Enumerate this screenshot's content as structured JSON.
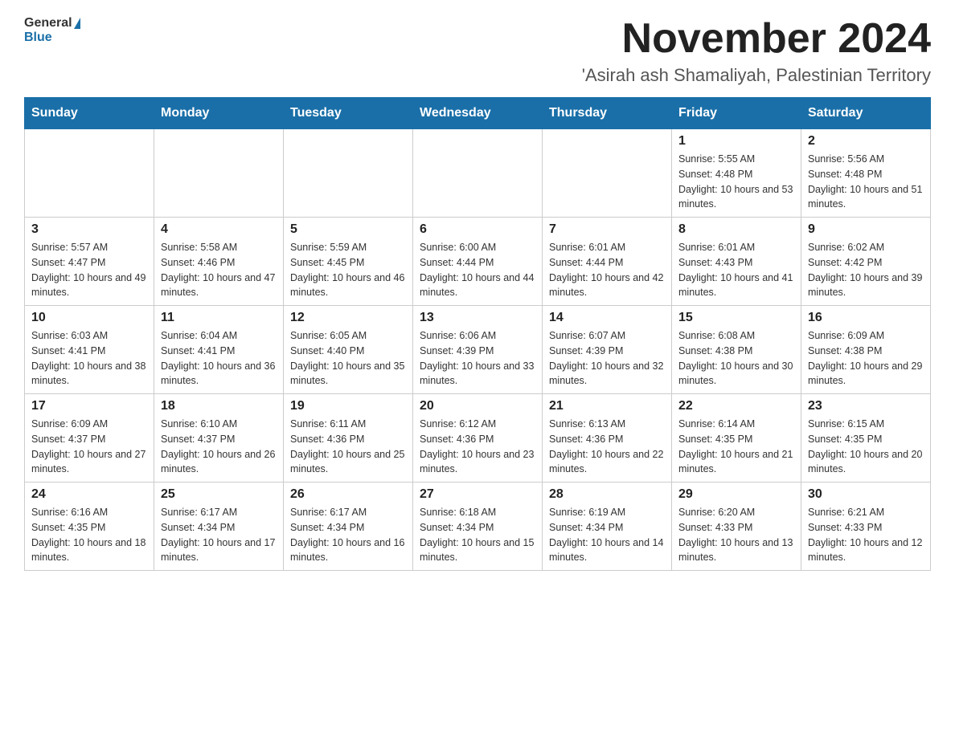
{
  "header": {
    "logo_general": "General",
    "logo_blue": "Blue",
    "month_title": "November 2024",
    "subtitle": "'Asirah ash Shamaliyah, Palestinian Territory"
  },
  "days_of_week": [
    "Sunday",
    "Monday",
    "Tuesday",
    "Wednesday",
    "Thursday",
    "Friday",
    "Saturday"
  ],
  "weeks": [
    [
      {
        "day": "",
        "info": ""
      },
      {
        "day": "",
        "info": ""
      },
      {
        "day": "",
        "info": ""
      },
      {
        "day": "",
        "info": ""
      },
      {
        "day": "",
        "info": ""
      },
      {
        "day": "1",
        "info": "Sunrise: 5:55 AM\nSunset: 4:48 PM\nDaylight: 10 hours and 53 minutes."
      },
      {
        "day": "2",
        "info": "Sunrise: 5:56 AM\nSunset: 4:48 PM\nDaylight: 10 hours and 51 minutes."
      }
    ],
    [
      {
        "day": "3",
        "info": "Sunrise: 5:57 AM\nSunset: 4:47 PM\nDaylight: 10 hours and 49 minutes."
      },
      {
        "day": "4",
        "info": "Sunrise: 5:58 AM\nSunset: 4:46 PM\nDaylight: 10 hours and 47 minutes."
      },
      {
        "day": "5",
        "info": "Sunrise: 5:59 AM\nSunset: 4:45 PM\nDaylight: 10 hours and 46 minutes."
      },
      {
        "day": "6",
        "info": "Sunrise: 6:00 AM\nSunset: 4:44 PM\nDaylight: 10 hours and 44 minutes."
      },
      {
        "day": "7",
        "info": "Sunrise: 6:01 AM\nSunset: 4:44 PM\nDaylight: 10 hours and 42 minutes."
      },
      {
        "day": "8",
        "info": "Sunrise: 6:01 AM\nSunset: 4:43 PM\nDaylight: 10 hours and 41 minutes."
      },
      {
        "day": "9",
        "info": "Sunrise: 6:02 AM\nSunset: 4:42 PM\nDaylight: 10 hours and 39 minutes."
      }
    ],
    [
      {
        "day": "10",
        "info": "Sunrise: 6:03 AM\nSunset: 4:41 PM\nDaylight: 10 hours and 38 minutes."
      },
      {
        "day": "11",
        "info": "Sunrise: 6:04 AM\nSunset: 4:41 PM\nDaylight: 10 hours and 36 minutes."
      },
      {
        "day": "12",
        "info": "Sunrise: 6:05 AM\nSunset: 4:40 PM\nDaylight: 10 hours and 35 minutes."
      },
      {
        "day": "13",
        "info": "Sunrise: 6:06 AM\nSunset: 4:39 PM\nDaylight: 10 hours and 33 minutes."
      },
      {
        "day": "14",
        "info": "Sunrise: 6:07 AM\nSunset: 4:39 PM\nDaylight: 10 hours and 32 minutes."
      },
      {
        "day": "15",
        "info": "Sunrise: 6:08 AM\nSunset: 4:38 PM\nDaylight: 10 hours and 30 minutes."
      },
      {
        "day": "16",
        "info": "Sunrise: 6:09 AM\nSunset: 4:38 PM\nDaylight: 10 hours and 29 minutes."
      }
    ],
    [
      {
        "day": "17",
        "info": "Sunrise: 6:09 AM\nSunset: 4:37 PM\nDaylight: 10 hours and 27 minutes."
      },
      {
        "day": "18",
        "info": "Sunrise: 6:10 AM\nSunset: 4:37 PM\nDaylight: 10 hours and 26 minutes."
      },
      {
        "day": "19",
        "info": "Sunrise: 6:11 AM\nSunset: 4:36 PM\nDaylight: 10 hours and 25 minutes."
      },
      {
        "day": "20",
        "info": "Sunrise: 6:12 AM\nSunset: 4:36 PM\nDaylight: 10 hours and 23 minutes."
      },
      {
        "day": "21",
        "info": "Sunrise: 6:13 AM\nSunset: 4:36 PM\nDaylight: 10 hours and 22 minutes."
      },
      {
        "day": "22",
        "info": "Sunrise: 6:14 AM\nSunset: 4:35 PM\nDaylight: 10 hours and 21 minutes."
      },
      {
        "day": "23",
        "info": "Sunrise: 6:15 AM\nSunset: 4:35 PM\nDaylight: 10 hours and 20 minutes."
      }
    ],
    [
      {
        "day": "24",
        "info": "Sunrise: 6:16 AM\nSunset: 4:35 PM\nDaylight: 10 hours and 18 minutes."
      },
      {
        "day": "25",
        "info": "Sunrise: 6:17 AM\nSunset: 4:34 PM\nDaylight: 10 hours and 17 minutes."
      },
      {
        "day": "26",
        "info": "Sunrise: 6:17 AM\nSunset: 4:34 PM\nDaylight: 10 hours and 16 minutes."
      },
      {
        "day": "27",
        "info": "Sunrise: 6:18 AM\nSunset: 4:34 PM\nDaylight: 10 hours and 15 minutes."
      },
      {
        "day": "28",
        "info": "Sunrise: 6:19 AM\nSunset: 4:34 PM\nDaylight: 10 hours and 14 minutes."
      },
      {
        "day": "29",
        "info": "Sunrise: 6:20 AM\nSunset: 4:33 PM\nDaylight: 10 hours and 13 minutes."
      },
      {
        "day": "30",
        "info": "Sunrise: 6:21 AM\nSunset: 4:33 PM\nDaylight: 10 hours and 12 minutes."
      }
    ]
  ]
}
